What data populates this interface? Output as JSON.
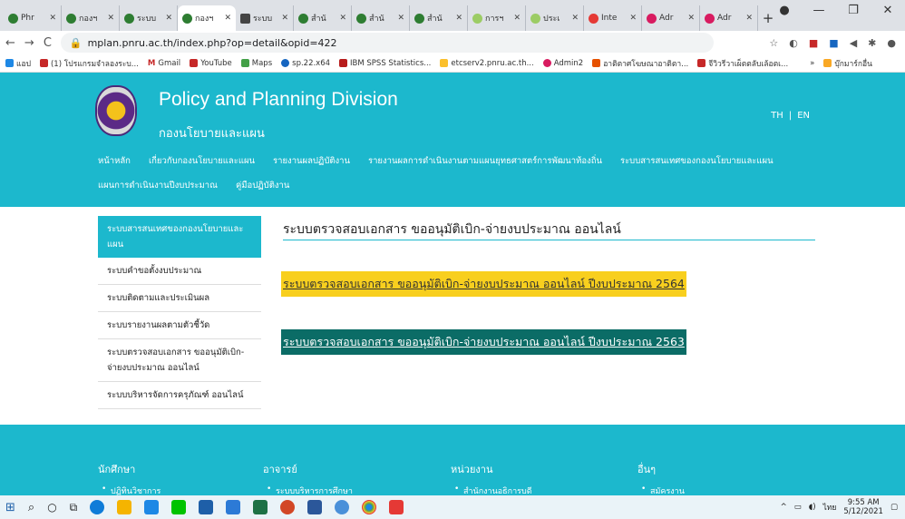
{
  "browser": {
    "tabs": [
      {
        "label": "Phr"
      },
      {
        "label": "กองฯ"
      },
      {
        "label": "ระบบ"
      },
      {
        "label": "กองฯ"
      },
      {
        "label": "ระบบ"
      },
      {
        "label": "สำนั"
      },
      {
        "label": "สำนั"
      },
      {
        "label": "สำนั"
      },
      {
        "label": "การฯ"
      },
      {
        "label": "ประเ"
      },
      {
        "label": "Inte"
      },
      {
        "label": "Adr"
      },
      {
        "label": "Adr"
      }
    ],
    "url": "mplan.pnru.ac.th/index.php?op=detail&opid=422",
    "bookmarks": [
      {
        "label": "แอป"
      },
      {
        "label": "(1) โปรแกรมจำลองระบ..."
      },
      {
        "label": "Gmail"
      },
      {
        "label": "YouTube"
      },
      {
        "label": "Maps"
      },
      {
        "label": "sp.22.x64"
      },
      {
        "label": "IBM SPSS Statistics..."
      },
      {
        "label": "etcserv2.pnru.ac.th..."
      },
      {
        "label": "Admin2"
      },
      {
        "label": "อาติตาศโฆษณาอาติตา..."
      },
      {
        "label": "จีวิวรีวาเผ็ตตลับเล้อตเ..."
      },
      {
        "label": "»"
      },
      {
        "label": "บุ๊กมาร์กอื่น"
      }
    ]
  },
  "header": {
    "title": "Policy and Planning Division",
    "subtitle": "กองนโยบายและแผน",
    "lang_th": "TH",
    "lang_sep": "|",
    "lang_en": "EN"
  },
  "nav": [
    {
      "label": "หน้าหลัก"
    },
    {
      "label": "เกี่ยวกับกองนโยบายและแผน"
    },
    {
      "label": "รายงานผลปฏิบัติงาน"
    },
    {
      "label": "รายงานผลการดำเนินงานตามแผนยุทธศาสตร์การพัฒนาท้องถิ่น"
    },
    {
      "label": "ระบบสารสนเทศของกองนโยบายและแผน"
    },
    {
      "label": "แผนการดำเนินงานปีงบประมาณ"
    },
    {
      "label": "คู่มือปฏิบัติงาน"
    }
  ],
  "sidebar": [
    {
      "label": "ระบบสารสนเทศของกองนโยบายและแผน"
    },
    {
      "label": "ระบบคำขอตั้งงบประมาณ"
    },
    {
      "label": "ระบบติดตามและประเมินผล"
    },
    {
      "label": "ระบบรายงานผลตามตัวชี้วัด"
    },
    {
      "label": "ระบบตรวจสอบเอกสาร ขออนุมัติเบิก-จ่ายงบประมาณ ออนไลน์"
    },
    {
      "label": "ระบบบริหารจัดการครุภัณฑ์ ออนไลน์"
    }
  ],
  "content": {
    "title": "ระบบตรวจสอบเอกสาร ขออนุมัติเบิก-จ่ายงบประมาณ ออนไลน์",
    "link1": "ระบบตรวจสอบเอกสาร ขออนุมัติเบิก-จ่ายงบประมาณ ออนไลน์ ปีงบประมาณ 2564",
    "link2": "ระบบตรวจสอบเอกสาร ขออนุมัติเบิก-จ่ายงบประมาณ ออนไลน์ ปีงบประมาณ 2563"
  },
  "footer": {
    "cols": [
      {
        "title": "นักศึกษา",
        "item": "ปฏิทินวิชาการ"
      },
      {
        "title": "อาจารย์",
        "item": "ระบบบริหารการศึกษา"
      },
      {
        "title": "หน่วยงาน",
        "item": "สำนักงานอธิการบดี"
      },
      {
        "title": "อื่นๆ",
        "item": "สมัครงาน"
      }
    ]
  },
  "taskbar": {
    "lang": "ไทย",
    "time": "9:55 AM",
    "date": "5/12/2021"
  },
  "colors": {
    "primary": "#1cb8cd",
    "link1_bg": "#f8cf1e",
    "link2_bg": "#0b6c66"
  }
}
